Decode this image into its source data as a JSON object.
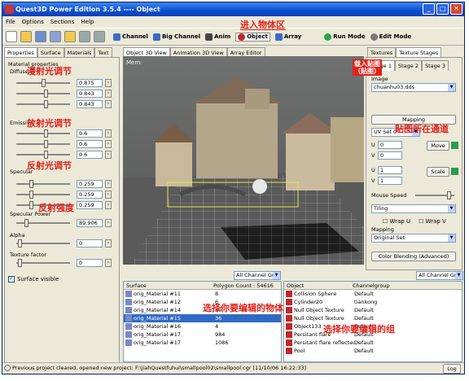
{
  "window": {
    "title": "Quest3D Power Edition 3.5.4     ----     Object"
  },
  "menu": [
    "File",
    "Options",
    "Sections",
    "Help"
  ],
  "toolbar": {
    "buttons": [
      {
        "label": "Channel"
      },
      {
        "label": "Big Channel"
      },
      {
        "label": "Anim"
      },
      {
        "label": "Object"
      },
      {
        "label": "Array"
      },
      {
        "label": "Run Mode"
      },
      {
        "label": "Edit Mode"
      }
    ]
  },
  "annotations": {
    "enter_object": "进入物体区",
    "diffuse": "漫射光调节",
    "emissive": "放射光调节",
    "specular": "反射光调节",
    "power": "反射强度",
    "pick_object": "选择你要编辑的物体",
    "pick_group": "选择你要编辑的组",
    "channel_map": "贴图所在通道",
    "load_texture": "载入贴图\n（贴图）"
  },
  "left_tabs": [
    "Properties",
    "Surface",
    "Materials",
    "Text"
  ],
  "material": {
    "group_title": "Material properties",
    "diffuse_label": "Diffuse",
    "diffuse_values": [
      "0.875",
      "0.843",
      "0.843"
    ],
    "emissive_label": "Emissive",
    "emissive_values": [
      "0.6",
      "0.6",
      "0.6"
    ],
    "specular_label": "Specular",
    "specular_values": [
      "0.259",
      "0.259",
      "0.259"
    ],
    "power_label": "Specular Power",
    "power_value": "89.906",
    "alpha_label": "Alpha",
    "alpha_value": "0",
    "texfactor_label": "Texture factor",
    "texfactor_value": "0",
    "surface_visible": "Surface visible"
  },
  "view_tabs": [
    "Object 3D View",
    "Animation 3D View",
    "Array Editor"
  ],
  "viewport": {
    "corner_label": "Mem:"
  },
  "right_tabs": [
    "Textures",
    "Texture Stages"
  ],
  "stage_tabs": [
    "Stage 1",
    "Stage 2",
    "Stage 3"
  ],
  "texture": {
    "image_label": "Image",
    "image_file": "chuanhu03.dds",
    "mapping_title": "Mapping",
    "uv_set": "UV Set 0",
    "move_btn": "Move",
    "scale_btn": "Scale",
    "u_label": "U",
    "v_label": "V",
    "u_val": "0",
    "v_val": "0",
    "u2_val": "1",
    "v2_val": "1",
    "mouse_speed": "Mouse Speed",
    "tiling": "Tiling",
    "wrap_u": "Wrap U",
    "wrap_v": "Wrap V",
    "mapping_label": "Mapping",
    "mapping_value": "Original Set",
    "color_blending": "Color Blending (Advanced)"
  },
  "surface_list": {
    "filter": "All Channel Gro",
    "headers": [
      "Surface",
      "Polygon Count : 54616"
    ],
    "rows": [
      [
        "orig_Material #11",
        "8"
      ],
      [
        "orig_Material #12",
        "6"
      ],
      [
        "orig_Material #14",
        "30"
      ],
      [
        "orig_Material #15",
        "36"
      ],
      [
        "orig_Material #16",
        "4"
      ],
      [
        "orig_Material #17",
        "984"
      ],
      [
        "orig_Material #17",
        "1086"
      ]
    ],
    "selected": 3
  },
  "object_list": {
    "filter": "All Channel Gro",
    "headers": [
      "Object",
      "Channelgroup"
    ],
    "rows": [
      [
        "Collision Sphere",
        "Default"
      ],
      [
        "Cylinder20",
        "tiankong"
      ],
      [
        "Null Object Texture",
        "Default"
      ],
      [
        "Null Object Texture",
        "Default"
      ],
      [
        "Object133",
        "Default"
      ],
      [
        "Persitant flare",
        "Default"
      ],
      [
        "Persitant flare reflected",
        "Default"
      ],
      [
        "Pool",
        "Default"
      ]
    ]
  },
  "status": {
    "text": "Previous project cleared, opened new project: F:\\jiahQuestfuhui\\smallpool02\\smallpool.cgr [11/10/06 16:22:33]",
    "log": "Log"
  }
}
